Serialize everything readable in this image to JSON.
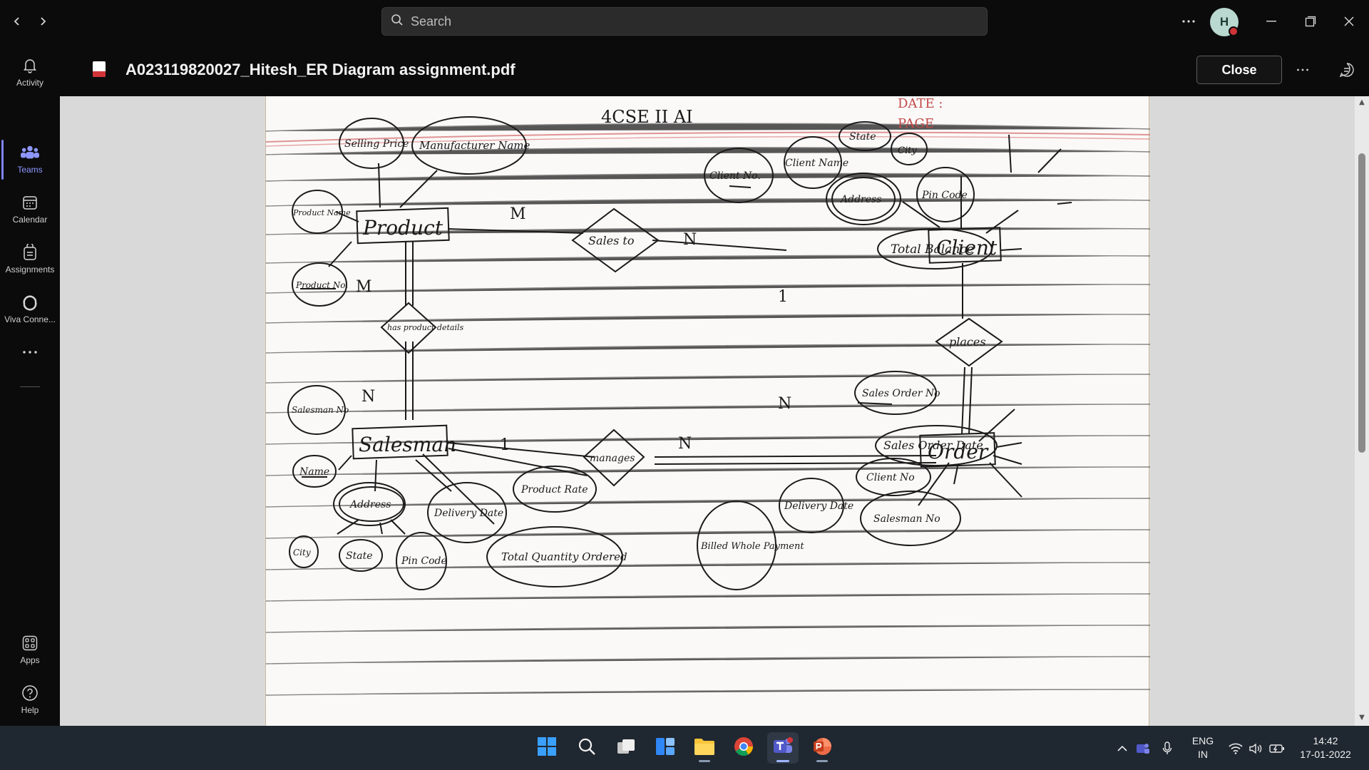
{
  "titlebar": {
    "search_placeholder": "Search",
    "avatar_initial": "H"
  },
  "rail": {
    "items": [
      {
        "label": "Activity",
        "icon": "bell-icon"
      },
      {
        "label": "Teams",
        "icon": "teams-icon",
        "active": true
      },
      {
        "label": "Calendar",
        "icon": "calendar-icon"
      },
      {
        "label": "Assignments",
        "icon": "assignments-icon"
      },
      {
        "label": "Viva Conne...",
        "icon": "viva-icon"
      },
      {
        "label": "Apps",
        "icon": "apps-icon"
      },
      {
        "label": "Help",
        "icon": "help-icon"
      }
    ]
  },
  "document": {
    "title": "A023119820027_Hitesh_ER Diagram assignment.pdf",
    "close_label": "Close"
  },
  "diagram": {
    "header_text": "4CSE II AI",
    "date_label": "DATE :",
    "page_label": "PAGE",
    "entities": [
      "Product",
      "Client",
      "Salesman",
      "Order"
    ],
    "relationships": [
      "Sales to",
      "has product details",
      "places",
      "manages"
    ],
    "attributes": {
      "product": [
        "Selling Price",
        "Manufacturer Name",
        "Product Name",
        "Product No."
      ],
      "client": [
        "Client No.",
        "Client Name",
        "State",
        "City",
        "Address",
        "Pin Code",
        "Total Balance"
      ],
      "salesman": [
        "Salesman No",
        "Name",
        "Address",
        "City",
        "State",
        "Pin Code",
        "Delivery Date",
        "Product Rate",
        "Total Quantity Ordered"
      ],
      "order": [
        "Sales Order No",
        "Sales Order Date",
        "Client No",
        "Salesman No",
        "Delivery Date",
        "Billed Whole Payment"
      ]
    },
    "cardinalities": [
      "M",
      "N",
      "M",
      "N",
      "1",
      "N",
      "1",
      "N"
    ]
  },
  "taskbar": {
    "language": "ENG",
    "region": "IN",
    "time": "14:42",
    "date": "17-01-2022"
  }
}
